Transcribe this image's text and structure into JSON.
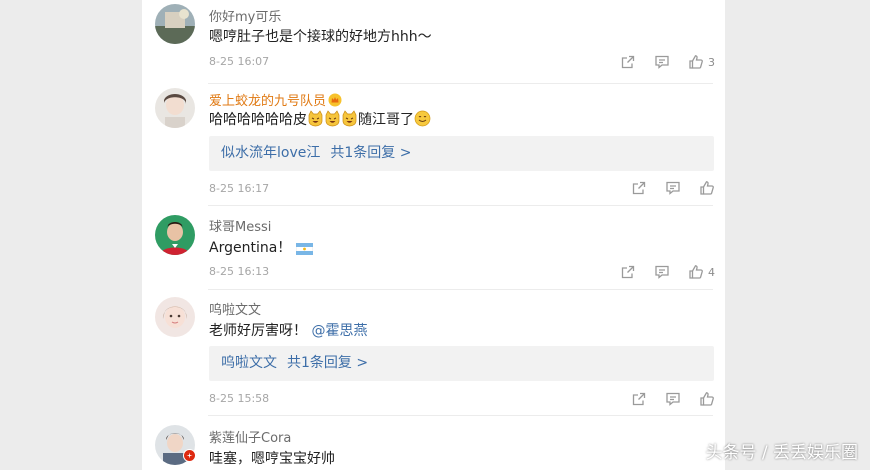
{
  "comments": [
    {
      "user": "你好my可乐",
      "text": "嗯哼肚子也是个接球的好地方hhh～",
      "time": "8-25 16:07",
      "likes": "3"
    },
    {
      "user": "爱上蛟龙的九号队员",
      "text_before": "哈哈哈哈哈哈皮",
      "text_after": "随江哥了",
      "reply_user": "似水流年love江",
      "reply_count": "共1条回复 >",
      "time": "8-25 16:17",
      "likes": ""
    },
    {
      "user": "球哥Messi",
      "text": "Argentina！",
      "time": "8-25 16:13",
      "likes": "4"
    },
    {
      "user": "呜啦文文",
      "text": "老师好厉害呀！",
      "mention": "@霍思燕",
      "reply_user": "呜啦文文",
      "reply_count": "共1条回复 >",
      "time": "8-25 15:58",
      "likes": ""
    },
    {
      "user": "紫莲仙子Cora",
      "text": "哇塞，嗯哼宝宝好帅"
    }
  ],
  "watermark": "头条号 / 丢丢娱乐圈",
  "colors": {
    "name": "#6b6b6b",
    "vip_name": "#e07a14",
    "link": "#3d6ea8",
    "time": "#a6a6a6",
    "reply_bg": "#f2f2f2",
    "side_bg": "#ececec"
  },
  "icons": [
    "share-icon",
    "comment-icon",
    "thumb-up-icon",
    "flag-argentina-icon",
    "laughing-cat-emoji",
    "smile-emoji",
    "vip-crown-badge"
  ]
}
